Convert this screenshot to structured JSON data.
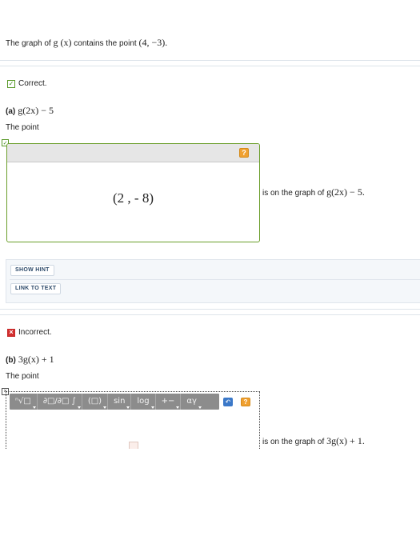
{
  "intro": {
    "text": "The graph of",
    "func": "g (x)",
    "text2": "contains the point",
    "point": "(4, −3)."
  },
  "part_a": {
    "status": "Correct.",
    "label": "(a)",
    "expression": "g(2x) − 5",
    "prompt": "The point",
    "answer": "(2 , - 8)",
    "suffix_text": "is on the graph of",
    "suffix_expr": "g(2x) − 5."
  },
  "hints": {
    "show_hint": "SHOW HINT",
    "link_to_text": "LINK TO TEXT"
  },
  "part_b": {
    "status": "Incorrect.",
    "label": "(b)",
    "expression": "3g(x) + 1",
    "prompt": "The point",
    "suffix_text": "is on the graph of",
    "suffix_expr": "3g(x) + 1."
  },
  "toolbar": {
    "items": [
      "ⁿ√□",
      "∂□/∂□ ∫",
      "(□)",
      "sin",
      "log",
      "+−",
      "αγ"
    ],
    "undo": "↶",
    "help": "?"
  },
  "icons": {
    "check": "✓",
    "cross": "×",
    "help": "?"
  }
}
